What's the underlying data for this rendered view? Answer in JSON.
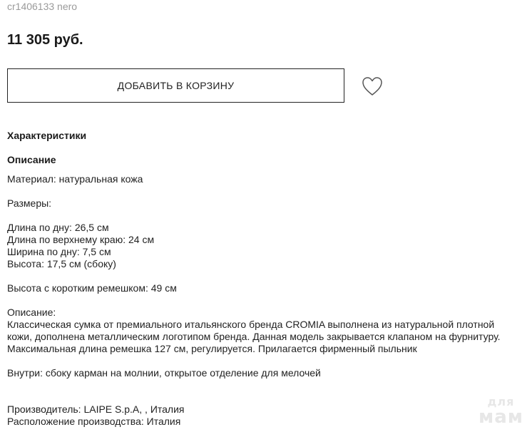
{
  "product": {
    "sku": "cr1406133 nero",
    "price": "11 305 руб."
  },
  "actions": {
    "add_to_cart_label": "ДОБАВИТЬ В КОРЗИНУ",
    "favorite_icon": "heart-outline-icon"
  },
  "details": {
    "characteristics_heading": "Характеристики",
    "description_heading": "Описание",
    "material": "Материал: натуральная кожа",
    "sizes_label": "Размеры:",
    "sizes": [
      "Длина по дну: 26,5 см",
      "Длина по верхнему краю: 24 см",
      "Ширина по дну: 7,5 см",
      "Высота: 17,5 см (сбоку)"
    ],
    "strap_height": "Высота с коротким ремешком: 49 см",
    "description_label": "Описание:",
    "description_lines": [
      "Классическая сумка от премиального итальянского бренда CROMIA выполнена из натуральной плотной",
      "кожи, дополнена металлическим логотипом бренда. Данная модель закрывается клапаном на фурнитуру.",
      "Максимальная длина ремешка 127 см, регулируется. Прилагается фирменный пыльник"
    ],
    "inside": "Внутри: сбоку карман на молнии, открытое отделение для мелочей",
    "manufacturer": "Производитель: LAIPE S.p.A, , Италия",
    "production_location": "Расположение производства: Италия"
  },
  "watermark": {
    "line1": "для",
    "line2": "мам"
  }
}
